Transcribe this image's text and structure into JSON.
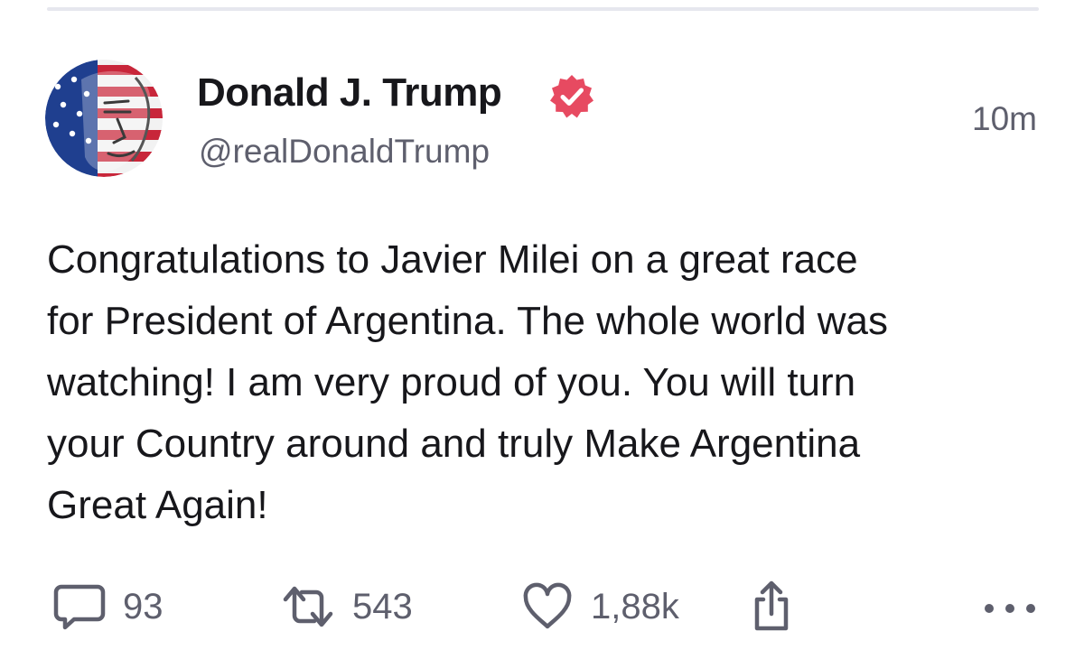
{
  "post": {
    "author": {
      "display_name": "Donald J. Trump",
      "handle": "@realDonaldTrump",
      "verified": true,
      "avatar_icon": "stars-and-stripes-portrait-avatar"
    },
    "timestamp": "10m",
    "body_lines": [
      "Congratulations to Javier Milei on a great race",
      "for President of Argentina. The whole world was",
      "watching! I am very proud of you. You will turn",
      "your Country around and truly Make Argentina",
      "Great Again!"
    ],
    "actions": {
      "replies": "93",
      "reposts": "543",
      "likes": "1,88k",
      "reply_icon": "speech-bubble-icon",
      "repost_icon": "repost-arrows-icon",
      "like_icon": "heart-icon",
      "share_icon": "share-icon",
      "more_icon": "ellipsis-icon"
    }
  },
  "colors": {
    "verified_badge": "#e74a61",
    "text_primary": "#17171b",
    "text_secondary": "#5e5f6d",
    "divider": "#e6e7ee"
  }
}
